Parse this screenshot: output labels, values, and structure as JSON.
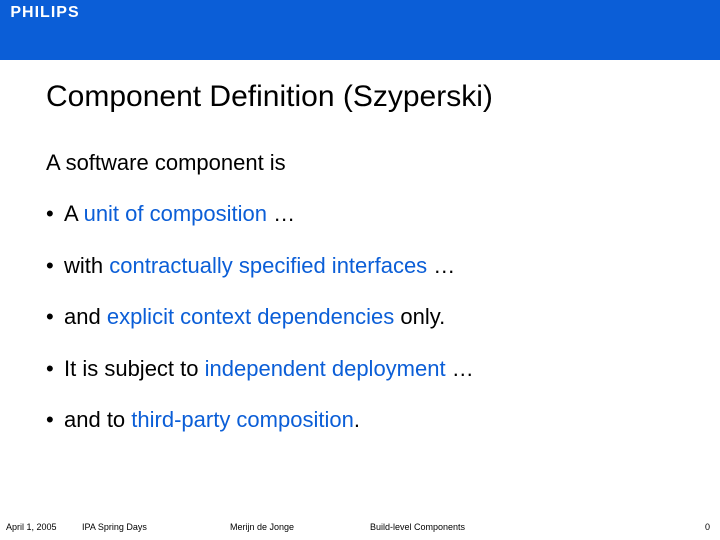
{
  "brand": {
    "logo_text": "PHILIPS"
  },
  "title": "Component Definition (Szyperski)",
  "intro": "A software component is",
  "bullets": [
    {
      "pre": "A ",
      "hl": "unit of composition",
      "post": " …"
    },
    {
      "pre": "with ",
      "hl": "contractually specified interfaces",
      "post": " …"
    },
    {
      "pre": "and ",
      "hl": "explicit context dependencies",
      "post": " only."
    },
    {
      "pre": "It is subject to ",
      "hl": "independent deployment",
      "post": " …"
    },
    {
      "pre": "and to ",
      "hl": "third-party composition",
      "post": "."
    }
  ],
  "footer": {
    "date": "April 1, 2005",
    "event": "IPA Spring Days",
    "author": "Merijn de Jonge",
    "topic": "Build-level Components",
    "page": "0"
  }
}
